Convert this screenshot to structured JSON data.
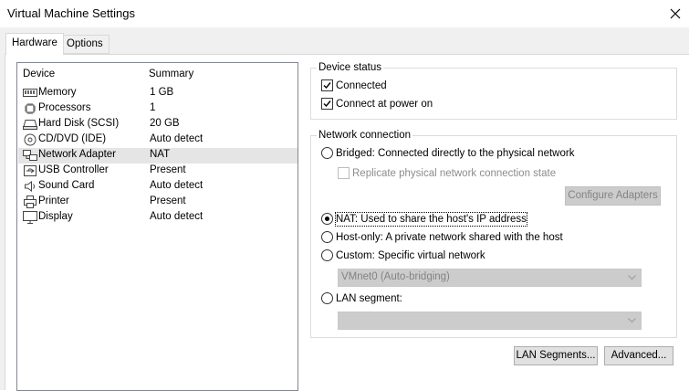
{
  "window": {
    "title": "Virtual Machine Settings"
  },
  "tabs": [
    {
      "label": "Hardware",
      "active": true
    },
    {
      "label": "Options",
      "active": false
    }
  ],
  "device_list": {
    "columns": [
      "Device",
      "Summary"
    ],
    "rows": [
      {
        "device": "Memory",
        "summary": "1 GB",
        "icon": "memory-icon"
      },
      {
        "device": "Processors",
        "summary": "1",
        "icon": "processor-icon"
      },
      {
        "device": "Hard Disk (SCSI)",
        "summary": "20 GB",
        "icon": "hard-disk-icon"
      },
      {
        "device": "CD/DVD (IDE)",
        "summary": "Auto detect",
        "icon": "cd-dvd-icon"
      },
      {
        "device": "Network Adapter",
        "summary": "NAT",
        "icon": "network-adapter-icon",
        "selected": true
      },
      {
        "device": "USB Controller",
        "summary": "Present",
        "icon": "usb-icon"
      },
      {
        "device": "Sound Card",
        "summary": "Auto detect",
        "icon": "speaker-icon"
      },
      {
        "device": "Printer",
        "summary": "Present",
        "icon": "printer-icon"
      },
      {
        "device": "Display",
        "summary": "Auto detect",
        "icon": "display-icon"
      }
    ]
  },
  "device_status": {
    "title": "Device status",
    "connected_label": "Connected",
    "connected_checked": true,
    "power_on_label": "Connect at power on",
    "power_on_checked": true
  },
  "network_connection": {
    "title": "Network connection",
    "bridged_label": "Bridged: Connected directly to the physical network",
    "replicate_label": "Replicate physical network connection state",
    "configure_adapters_label": "Configure Adapters",
    "nat_label": "NAT: Used to share the host's IP address",
    "host_only_label": "Host-only: A private network shared with the host",
    "custom_label": "Custom: Specific virtual network",
    "custom_value": "VMnet0 (Auto-bridging)",
    "lan_segment_label": "LAN segment:",
    "lan_segment_value": "",
    "selected": "nat"
  },
  "buttons": {
    "lan_segments": "LAN Segments...",
    "advanced": "Advanced..."
  }
}
